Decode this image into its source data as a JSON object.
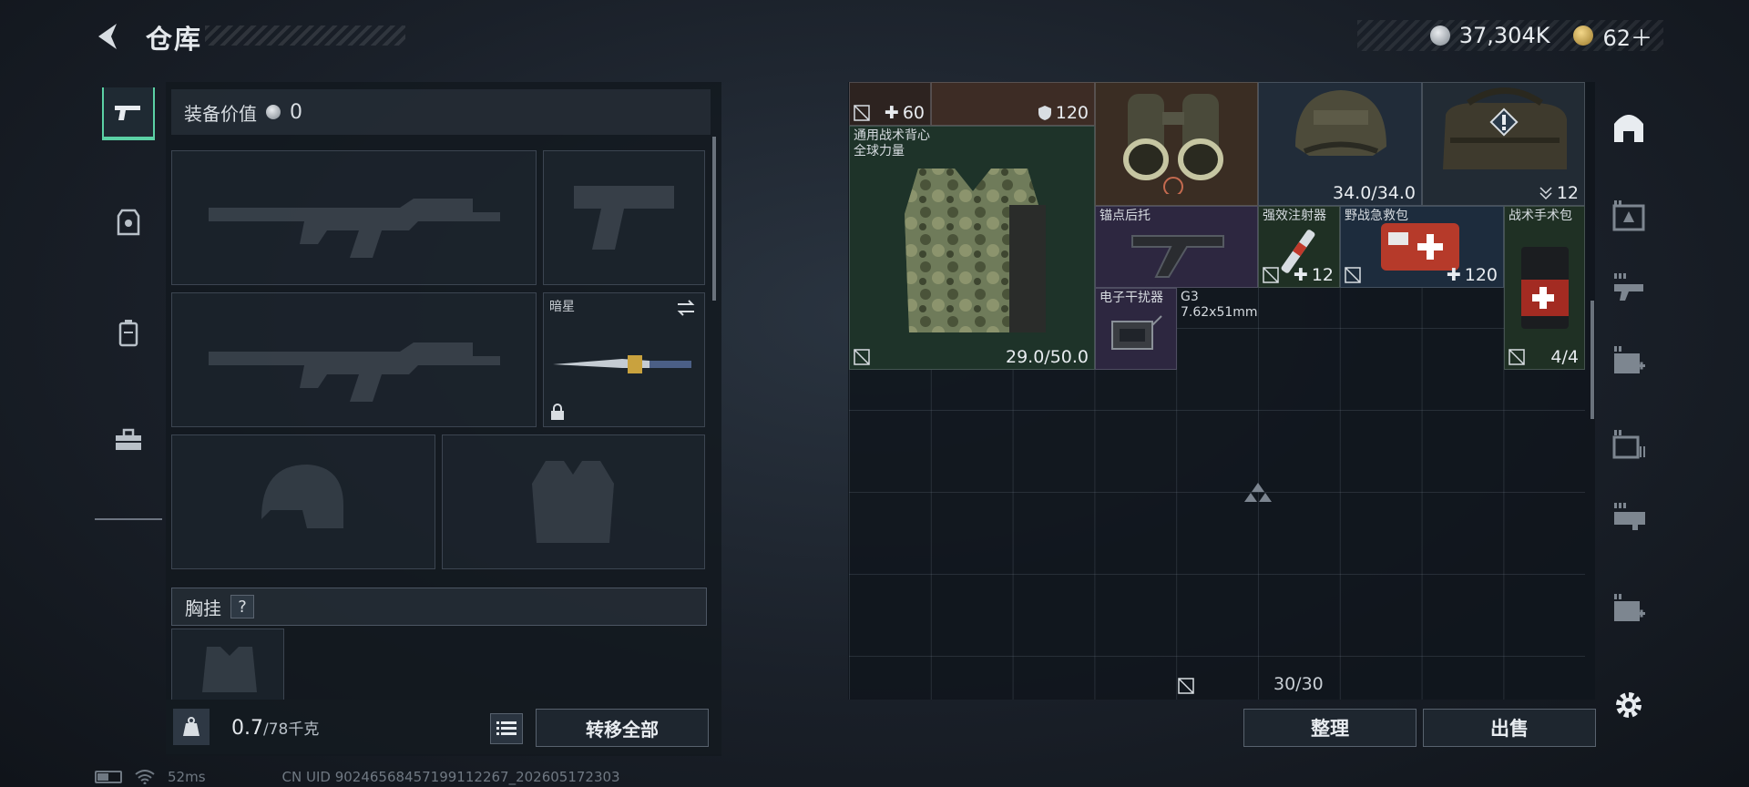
{
  "header": {
    "title": "仓库",
    "currency": [
      {
        "icon": "silver-coin-icon",
        "value": "37,304K"
      },
      {
        "icon": "gold-coin-icon",
        "value": "62＋"
      }
    ]
  },
  "equipment": {
    "value_label": "装备价值",
    "value": "0",
    "slots": {
      "melee_name": "暗星"
    },
    "chest_rig_label": "胸挂",
    "help": "?"
  },
  "weight": {
    "current": "0.7",
    "max": "/78千克"
  },
  "buttons": {
    "transfer_all": "转移全部",
    "organize": "整理",
    "sell": "出售"
  },
  "stash": {
    "items": [
      {
        "id": "top1",
        "qty": "60"
      },
      {
        "id": "top2",
        "qty": "120"
      },
      {
        "id": "vest",
        "name": "通用战术背心",
        "brand": "全球力量",
        "durability": "29.0/50.0"
      },
      {
        "id": "helmet",
        "durability": "34.0/34.0"
      },
      {
        "id": "bag",
        "count": "12"
      },
      {
        "id": "stock",
        "name": "锚点后托"
      },
      {
        "id": "injector",
        "name": "强效注射器",
        "qty": "12"
      },
      {
        "id": "medkit",
        "name": "野战急救包",
        "qty": "120"
      },
      {
        "id": "surgkit",
        "name": "战术手术包",
        "count": "4/4"
      },
      {
        "id": "jammer",
        "name": "电子干扰器"
      },
      {
        "id": "ammo",
        "name": "G3",
        "caliber": "7.62x51mm"
      }
    ],
    "capacity": "30/30"
  },
  "footer": {
    "ping": "52ms",
    "uid": "CN UID 90246568457199112267_202605172303"
  },
  "colors": {
    "accent": "#5bd1a5",
    "panel": "#12181f"
  }
}
